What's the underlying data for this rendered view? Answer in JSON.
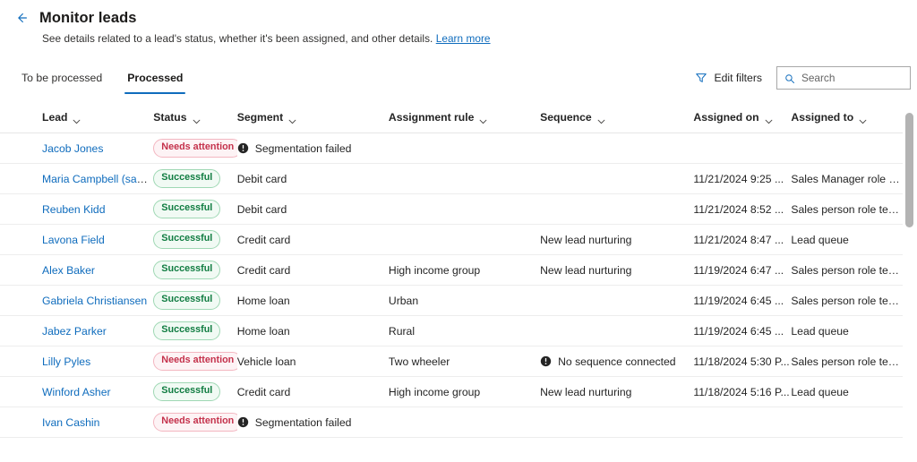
{
  "header": {
    "back_icon": "arrow-left-icon",
    "title": "Monitor leads",
    "subtitle": "See details related to a lead's status, whether it's been assigned, and other details.",
    "learn_more": "Learn more"
  },
  "command_bar": {
    "tabs": [
      {
        "label": "To be processed",
        "active": false
      },
      {
        "label": "Processed",
        "active": true
      }
    ],
    "edit_filters_label": "Edit filters",
    "edit_filters_icon": "funnel-icon",
    "search_placeholder": "Search",
    "search_value": "",
    "search_icon": "search-icon"
  },
  "table": {
    "columns": [
      {
        "key": "lead",
        "label": "Lead"
      },
      {
        "key": "status",
        "label": "Status"
      },
      {
        "key": "segment",
        "label": "Segment"
      },
      {
        "key": "assignment_rule",
        "label": "Assignment rule"
      },
      {
        "key": "sequence",
        "label": "Sequence"
      },
      {
        "key": "assigned_on",
        "label": "Assigned on"
      },
      {
        "key": "assigned_to",
        "label": "Assigned to"
      }
    ],
    "rows": [
      {
        "lead": "Jacob Jones",
        "status": "Needs attention",
        "status_kind": "attention",
        "segment": "Segmentation failed",
        "segment_icon": "info-filled-icon",
        "assignment_rule": "",
        "sequence": "",
        "sequence_icon": "",
        "assigned_on": "",
        "assigned_to": ""
      },
      {
        "lead": "Maria Campbell (sample)",
        "status": "Successful",
        "status_kind": "successful",
        "segment": "Debit card",
        "segment_icon": "",
        "assignment_rule": "",
        "sequence": "",
        "sequence_icon": "",
        "assigned_on": "11/21/2024 9:25 ...",
        "assigned_to": "Sales Manager role te.."
      },
      {
        "lead": "Reuben Kidd",
        "status": "Successful",
        "status_kind": "successful",
        "segment": "Debit card",
        "segment_icon": "",
        "assignment_rule": "",
        "sequence": "",
        "sequence_icon": "",
        "assigned_on": "11/21/2024 8:52 ...",
        "assigned_to": "Sales person role team"
      },
      {
        "lead": "Lavona Field",
        "status": "Successful",
        "status_kind": "successful",
        "segment": "Credit card",
        "segment_icon": "",
        "assignment_rule": "",
        "sequence": "New lead nurturing",
        "sequence_icon": "",
        "assigned_on": "11/21/2024 8:47 ...",
        "assigned_to": "Lead queue"
      },
      {
        "lead": "Alex Baker",
        "status": "Successful",
        "status_kind": "successful",
        "segment": "Credit card",
        "segment_icon": "",
        "assignment_rule": "High income group",
        "sequence": "New lead nurturing",
        "sequence_icon": "",
        "assigned_on": "11/19/2024 6:47 ...",
        "assigned_to": "Sales person role team"
      },
      {
        "lead": "Gabriela Christiansen",
        "status": "Successful",
        "status_kind": "successful",
        "segment": "Home loan",
        "segment_icon": "",
        "assignment_rule": "Urban",
        "sequence": "",
        "sequence_icon": "",
        "assigned_on": "11/19/2024 6:45 ...",
        "assigned_to": "Sales person role team"
      },
      {
        "lead": "Jabez Parker",
        "status": "Successful",
        "status_kind": "successful",
        "segment": "Home loan",
        "segment_icon": "",
        "assignment_rule": "Rural",
        "sequence": "",
        "sequence_icon": "",
        "assigned_on": "11/19/2024 6:45 ...",
        "assigned_to": "Lead queue"
      },
      {
        "lead": "Lilly Pyles",
        "status": "Needs attention",
        "status_kind": "attention",
        "segment": "Vehicle loan",
        "segment_icon": "",
        "assignment_rule": "Two wheeler",
        "sequence": "No sequence connected",
        "sequence_icon": "info-filled-icon",
        "assigned_on": "11/18/2024 5:30 P...",
        "assigned_to": "Sales person role team"
      },
      {
        "lead": "Winford Asher",
        "status": "Successful",
        "status_kind": "successful",
        "segment": "Credit card",
        "segment_icon": "",
        "assignment_rule": "High income group",
        "sequence": "New lead nurturing",
        "sequence_icon": "",
        "assigned_on": "11/18/2024 5:16 P...",
        "assigned_to": "Lead queue"
      },
      {
        "lead": "Ivan Cashin",
        "status": "Needs attention",
        "status_kind": "attention",
        "segment": "Segmentation failed",
        "segment_icon": "info-filled-icon",
        "assignment_rule": "",
        "sequence": "",
        "sequence_icon": "",
        "assigned_on": "",
        "assigned_to": ""
      }
    ]
  },
  "colors": {
    "accent": "#0f6cbd",
    "link": "#0f6cbd",
    "success_text": "#107c41",
    "success_border": "#9fd8b4",
    "attention_text": "#c4314b",
    "attention_border": "#f3b6c0",
    "row_divider": "#ededed"
  }
}
